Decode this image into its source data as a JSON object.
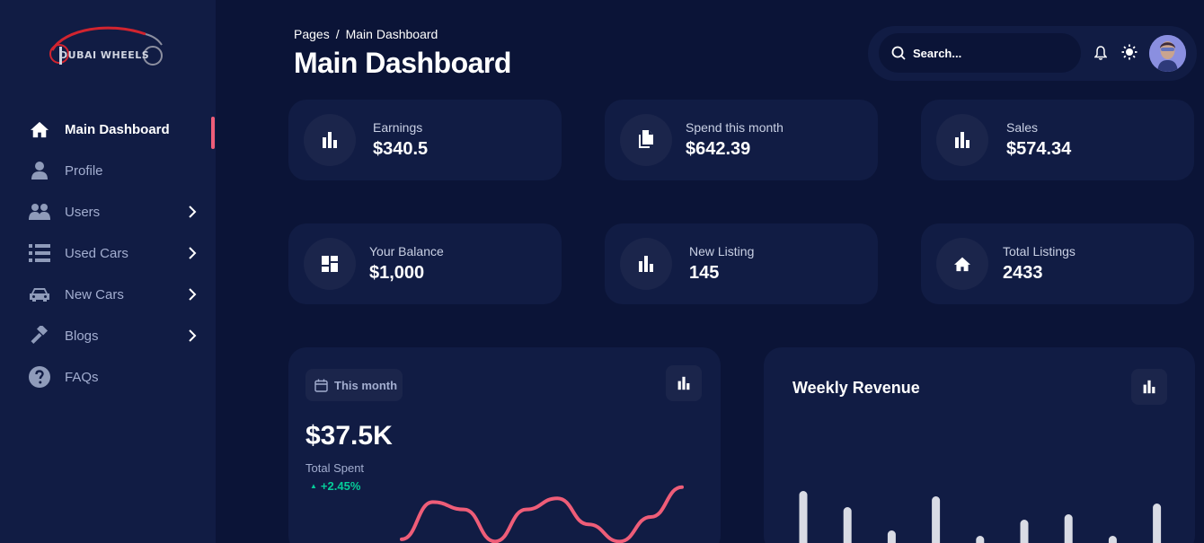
{
  "brand": {
    "logo_text": "DUBAI WHEELS"
  },
  "sidebar": {
    "items": [
      {
        "label": "Main Dashboard",
        "icon": "home-icon",
        "active": true,
        "has_chevron": false
      },
      {
        "label": "Profile",
        "icon": "user-icon",
        "active": false,
        "has_chevron": false
      },
      {
        "label": "Users",
        "icon": "users-icon",
        "active": false,
        "has_chevron": true
      },
      {
        "label": "Used Cars",
        "icon": "list-icon",
        "active": false,
        "has_chevron": true
      },
      {
        "label": "New Cars",
        "icon": "car-icon",
        "active": false,
        "has_chevron": true
      },
      {
        "label": "Blogs",
        "icon": "gavel-icon",
        "active": false,
        "has_chevron": true
      },
      {
        "label": "FAQs",
        "icon": "question-circle-icon",
        "active": false,
        "has_chevron": false
      }
    ]
  },
  "header": {
    "breadcrumb": {
      "root": "Pages",
      "separator": "/",
      "current": "Main Dashboard"
    },
    "title": "Main Dashboard",
    "search": {
      "placeholder": "Search...",
      "value": ""
    }
  },
  "stats": [
    {
      "label": "Earnings",
      "value": "$340.5",
      "icon": "bar-chart-icon"
    },
    {
      "label": "Spend this month",
      "value": "$642.39",
      "icon": "files-icon"
    },
    {
      "label": "Sales",
      "value": "$574.34",
      "icon": "bar-chart-icon"
    },
    {
      "label": "Your Balance",
      "value": "$1,000",
      "icon": "dashboard-grid-icon"
    },
    {
      "label": "New Listing",
      "value": "145",
      "icon": "bar-chart-icon"
    },
    {
      "label": "Total Listings",
      "value": "2433",
      "icon": "home-icon"
    }
  ],
  "total_spent": {
    "period_button": "This month",
    "value": "$37.5K",
    "label": "Total Spent",
    "change": "+2.45%"
  },
  "weekly_revenue": {
    "title": "Weekly Revenue"
  },
  "colors": {
    "background": "#0b1437",
    "card": "#111c44",
    "accent_line": "#ee5d78",
    "positive": "#05cd99",
    "bar": "#d9dbe4"
  },
  "chart_data": [
    {
      "type": "line",
      "series": [
        {
          "values": [
            0.05,
            0.55,
            0.45,
            0.02,
            0.45,
            0.6,
            0.25,
            0.02,
            0.35,
            0.75
          ]
        }
      ]
    },
    {
      "type": "bar",
      "series": [
        {
          "values": [
            70,
            52,
            26,
            64,
            20,
            38,
            44,
            20,
            56
          ]
        }
      ]
    }
  ]
}
